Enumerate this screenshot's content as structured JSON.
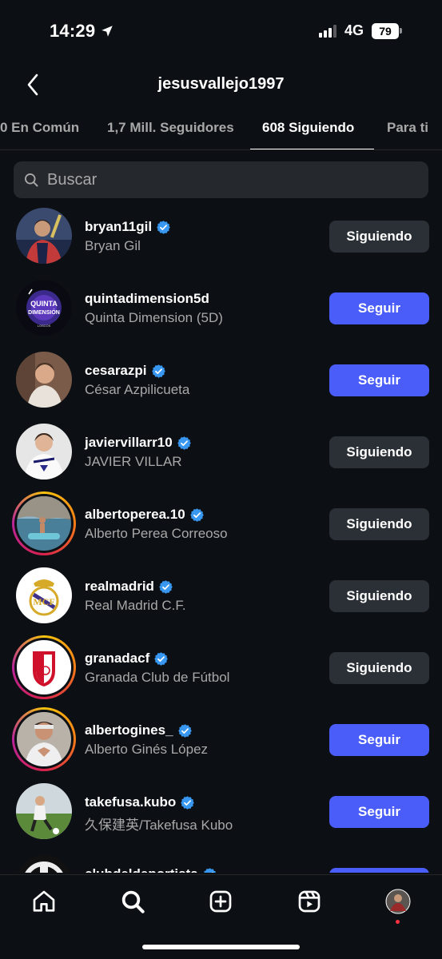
{
  "status_bar": {
    "time": "14:29",
    "network": "4G",
    "battery": "79"
  },
  "header": {
    "title": "jesusvallejo1997"
  },
  "tabs": [
    {
      "label": "0 En Común"
    },
    {
      "label": "1,7 Mill. Seguidores"
    },
    {
      "label": "608 Siguiendo",
      "active": true
    },
    {
      "label": "Para ti"
    }
  ],
  "search": {
    "placeholder": "Buscar"
  },
  "accounts": [
    {
      "username": "bryan11gil",
      "name": "Bryan Gil",
      "verified": true,
      "button": "Siguiendo",
      "state": "following"
    },
    {
      "username": "quintadimension5d",
      "name": "Quinta Dimension (5D)",
      "verified": false,
      "button": "Seguir",
      "state": "follow",
      "logo_text": [
        "QUINTA",
        "DIMENSIÓN",
        "LOSCOS"
      ]
    },
    {
      "username": "cesarazpi",
      "name": "César Azpilicueta",
      "verified": true,
      "button": "Seguir",
      "state": "follow"
    },
    {
      "username": "javiervillarr10",
      "name": "JAVIER VILLAR",
      "verified": true,
      "button": "Siguiendo",
      "state": "following"
    },
    {
      "username": "albertoperea.10",
      "name": "Alberto Perea Correoso",
      "verified": true,
      "button": "Siguiendo",
      "state": "following",
      "story_ring": true
    },
    {
      "username": "realmadrid",
      "name": "Real Madrid C.F.",
      "verified": true,
      "button": "Siguiendo",
      "state": "following"
    },
    {
      "username": "granadacf",
      "name": "Granada Club de Fútbol",
      "verified": true,
      "button": "Siguiendo",
      "state": "following",
      "story_ring": true
    },
    {
      "username": "albertogines_",
      "name": "Alberto Ginés López",
      "verified": true,
      "button": "Seguir",
      "state": "follow",
      "story_ring": true
    },
    {
      "username": "takefusa.kubo",
      "name": "久保建英/Takefusa Kubo",
      "verified": true,
      "button": "Seguir",
      "state": "follow"
    },
    {
      "username": "clubdeldeportista",
      "name": "",
      "verified": true,
      "button": "",
      "state": "follow"
    }
  ],
  "colors": {
    "background": "#0c1014",
    "follow_button": "#4a5df9",
    "following_button": "#2b3036",
    "verified_badge": "#3897f0",
    "secondary_text": "#a8a8a8"
  },
  "tab_bar": {
    "icons": [
      "home-icon",
      "search-icon",
      "create-icon",
      "reels-icon",
      "profile-avatar"
    ]
  }
}
